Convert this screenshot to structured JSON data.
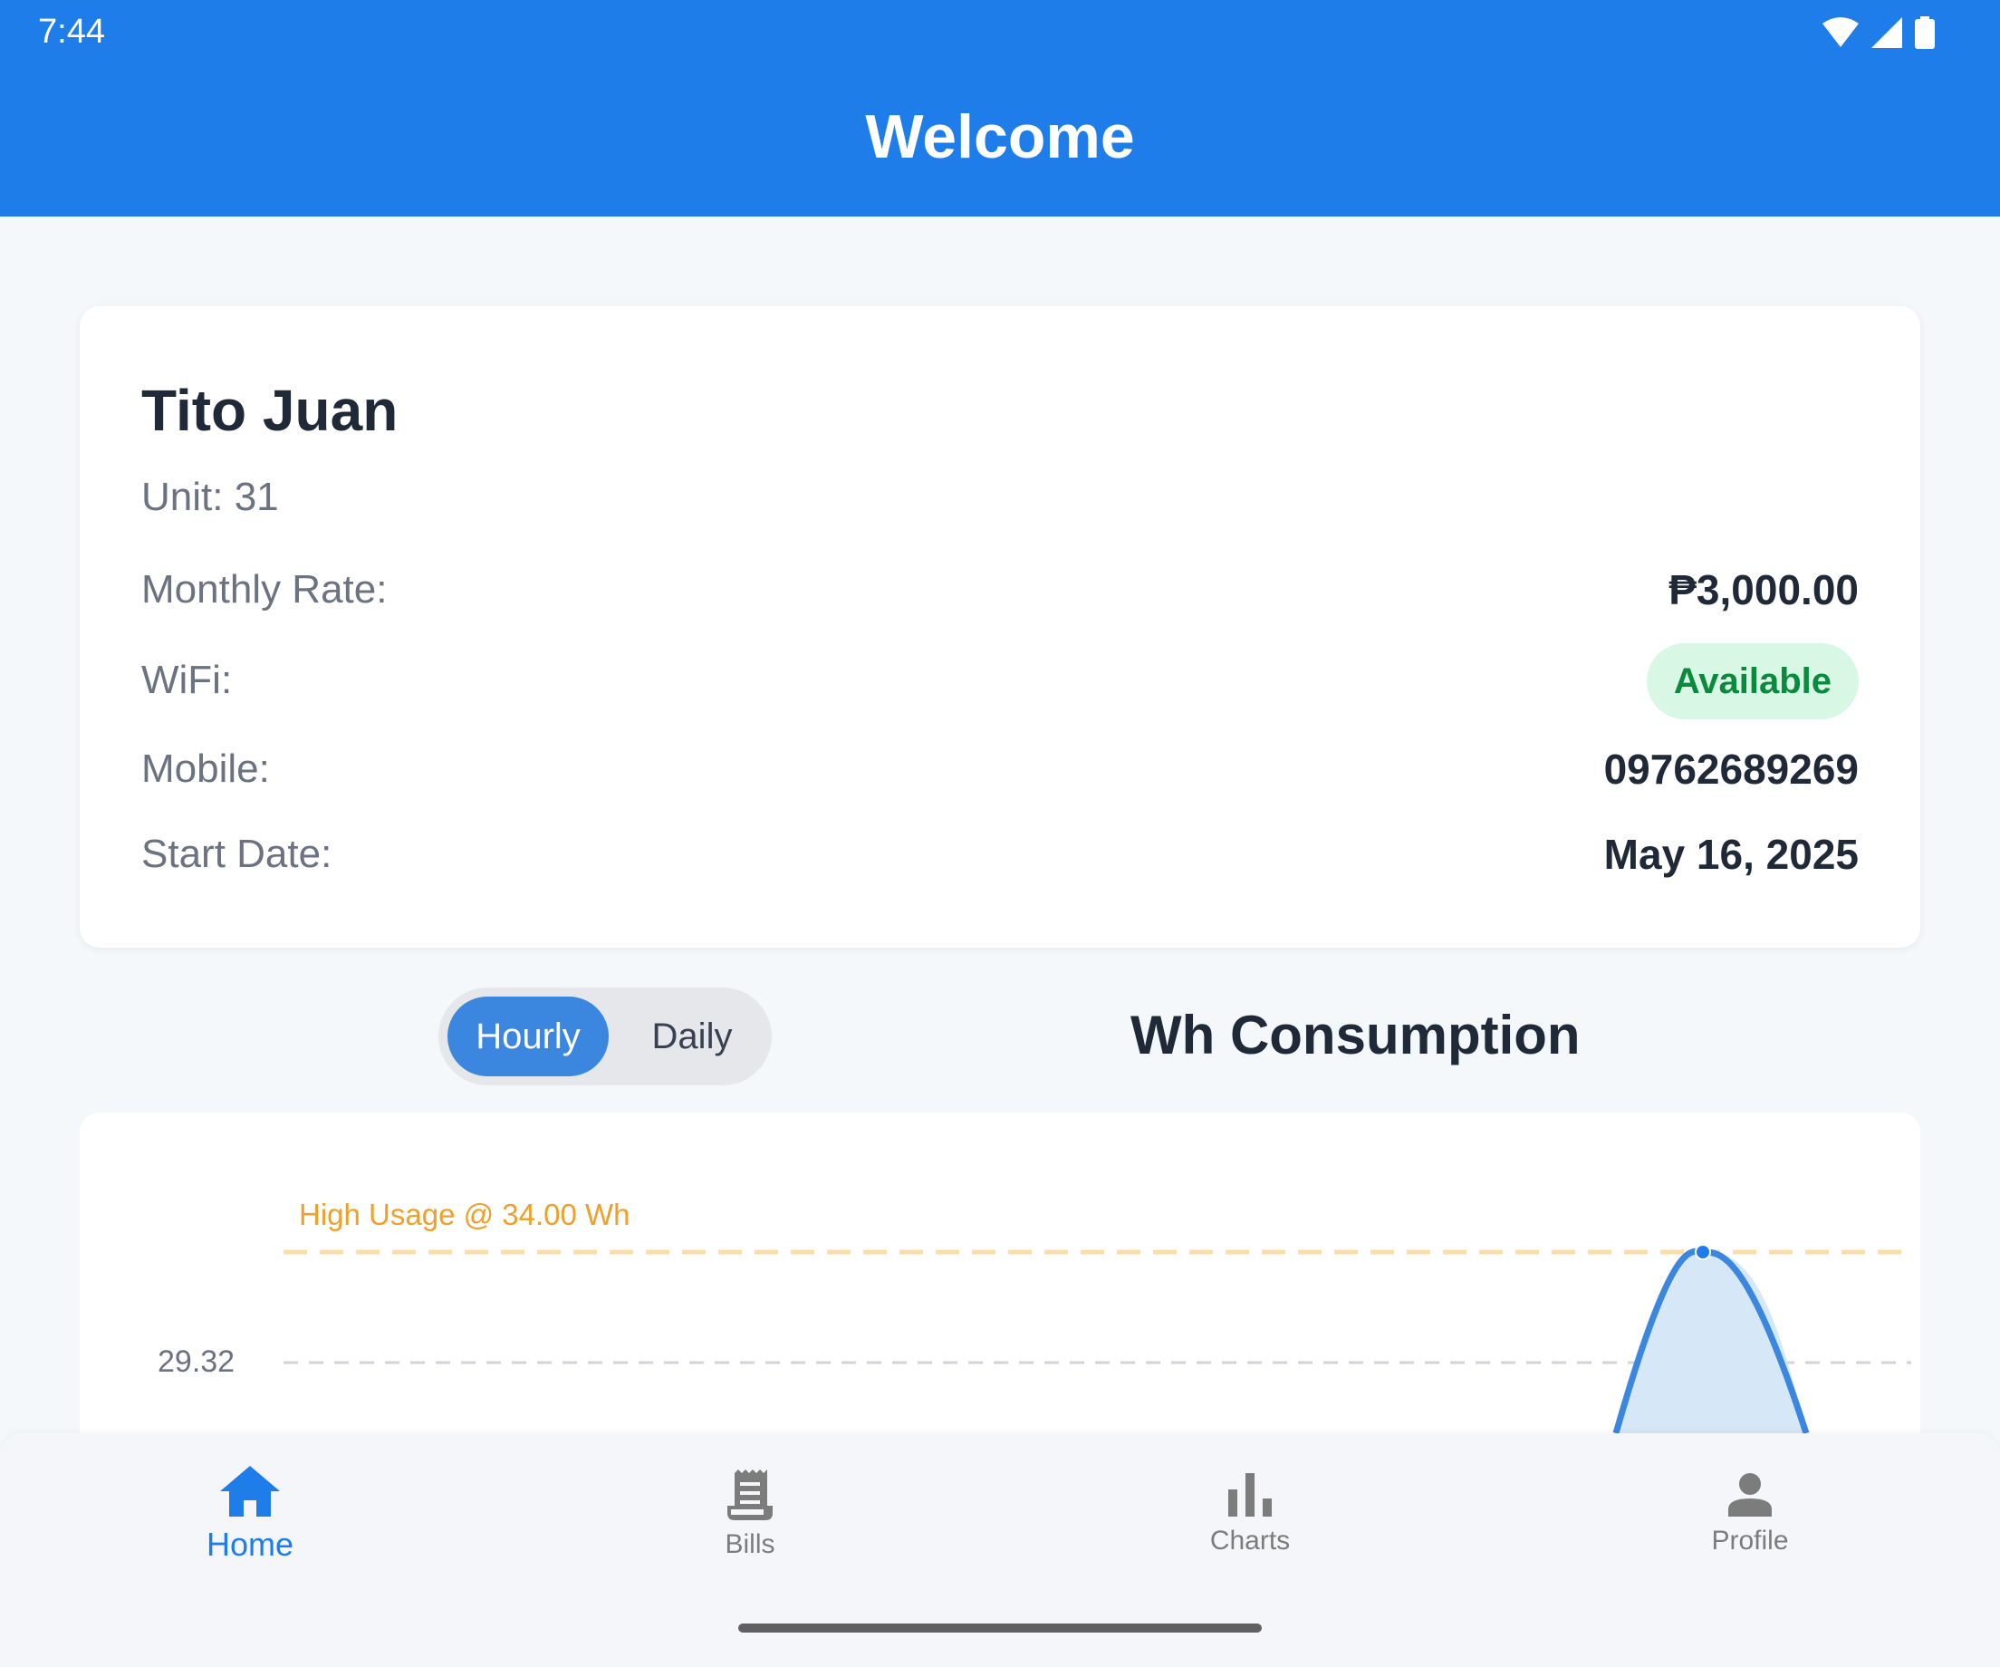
{
  "status_bar": {
    "time": "7:44"
  },
  "header": {
    "title": "Welcome"
  },
  "tenant": {
    "name": "Tito Juan",
    "unit": "Unit: 31",
    "monthly_rate_label": "Monthly Rate:",
    "monthly_rate_value": "₱3,000.00",
    "wifi_label": "WiFi:",
    "wifi_value": "Available",
    "mobile_label": "Mobile:",
    "mobile_value": "09762689269",
    "start_date_label": "Start Date:",
    "start_date_value": "May 16, 2025"
  },
  "toggle": {
    "options": [
      "Hourly",
      "Daily"
    ],
    "selected": "Hourly"
  },
  "chart_title": "Wh Consumption",
  "chart_data": {
    "type": "area",
    "y_ticks": [
      "29.32"
    ],
    "threshold": {
      "label": "High Usage @ 34.00 Wh",
      "value": 34.0
    },
    "visible_peak": 34.0,
    "grid": true,
    "colors": {
      "line": "#3B86DF",
      "fill": "#D6E8F8",
      "threshold": "#F9DEA8"
    }
  },
  "nav": {
    "items": [
      {
        "label": "Home",
        "icon": "home-icon",
        "active": true
      },
      {
        "label": "Bills",
        "icon": "receipt-icon",
        "active": false
      },
      {
        "label": "Charts",
        "icon": "bar-chart-icon",
        "active": false
      },
      {
        "label": "Profile",
        "icon": "person-icon",
        "active": false
      }
    ]
  },
  "colors": {
    "primary": "#1E7DE9",
    "success_bg": "#D9F7E5",
    "success_text": "#0B8A3E"
  }
}
